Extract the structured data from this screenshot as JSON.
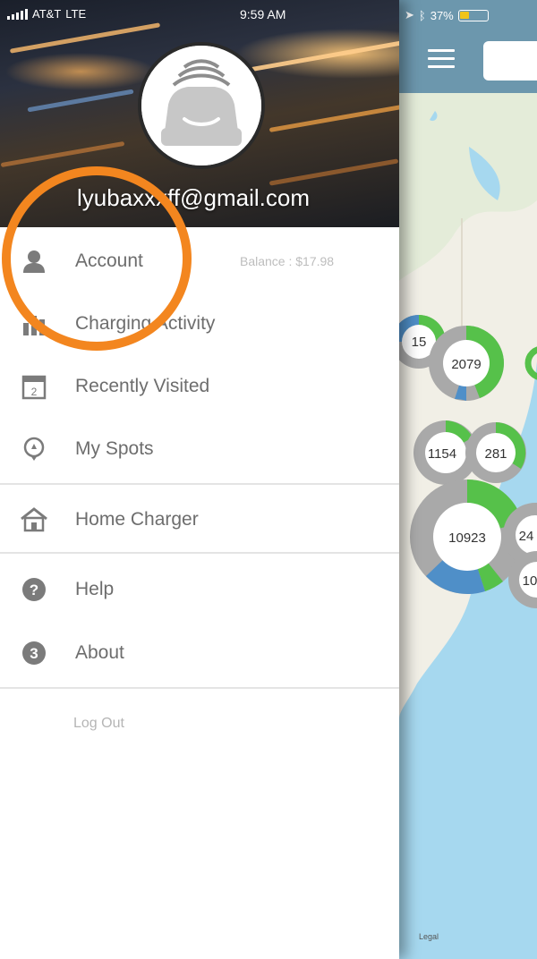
{
  "status_bar": {
    "carrier": "AT&T",
    "network": "LTE",
    "time": "9:59 AM",
    "battery": "37%"
  },
  "profile": {
    "email": "lyubaxxxff@gmail.com"
  },
  "menu": {
    "account": {
      "label": "Account",
      "balance": "Balance : $17.98"
    },
    "charging_activity": {
      "label": "Charging Activity"
    },
    "recently_visited": {
      "label": "Recently Visited"
    },
    "my_spots": {
      "label": "My Spots"
    },
    "home_charger": {
      "label": "Home Charger"
    },
    "help": {
      "label": "Help"
    },
    "about": {
      "label": "About"
    },
    "logout": {
      "label": "Log Out"
    }
  },
  "map": {
    "clusters": [
      "15",
      "2079",
      "1154",
      "281",
      "10923",
      "24",
      "10"
    ],
    "legal": "Legal"
  },
  "colors": {
    "annotation_circle": "#f3861f",
    "map_header": "#6c97ad",
    "cluster_green": "#56c14a",
    "cluster_blue": "#4f8fc8",
    "cluster_grey": "#a9a9a9",
    "ocean": "#a6d8ef",
    "land": "#f1efe6"
  },
  "icons": {
    "menu": "hamburger-icon",
    "account": "person-icon",
    "charging_activity": "bar-chart-icon",
    "recently_visited": "calendar-icon",
    "my_spots": "pin-icon",
    "home_charger": "house-icon",
    "help": "question-icon",
    "about": "info-icon"
  }
}
